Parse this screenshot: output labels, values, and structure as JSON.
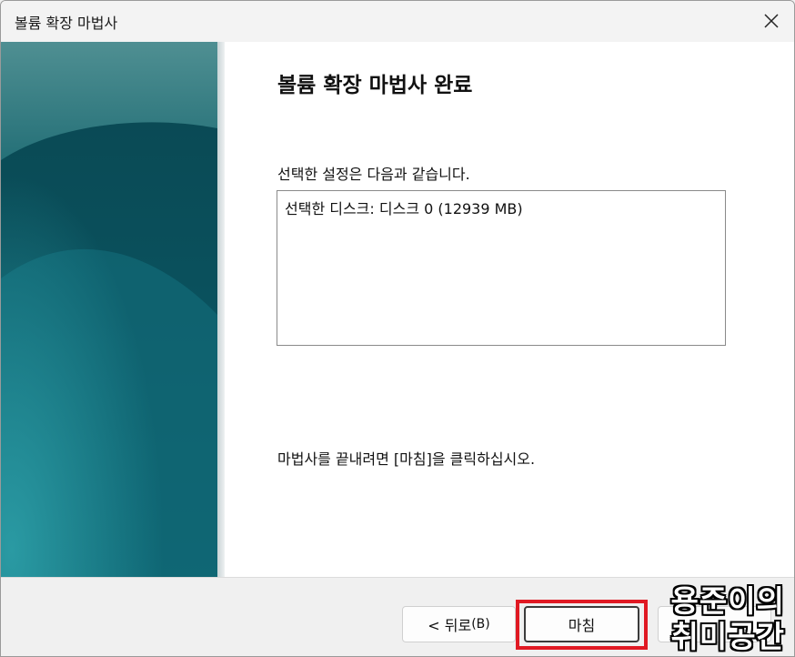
{
  "window": {
    "title": "볼륨 확장 마법사"
  },
  "content": {
    "heading": "볼륨 확장 마법사 완료",
    "settings_label": "선택한 설정은 다음과 같습니다.",
    "settings_value": "선택한 디스크: 디스크 0 (12939 MB)",
    "finish_instruction": "마법사를 끝내려면 [마침]을 클릭하십시오."
  },
  "footer": {
    "back_prefix": "< 뒤로",
    "back_key": "(B)",
    "finish_label": "마침"
  },
  "watermark": {
    "line1": "용준이의",
    "line2": "취미공간"
  },
  "colors": {
    "highlight_border": "#e01923",
    "side_panel_base": "#0d6e7c"
  }
}
